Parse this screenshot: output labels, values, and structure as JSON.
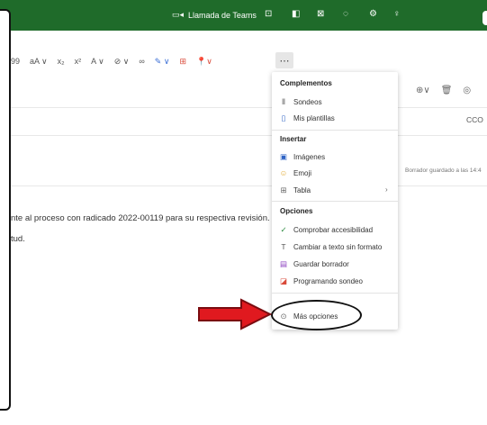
{
  "topbar": {
    "teams_label": "Llamada de Teams",
    "icons": [
      "chat-icon",
      "word-icon",
      "megaphone-icon",
      "bell-icon",
      "gear-icon",
      "lightbulb-icon"
    ]
  },
  "toolbar": {
    "quote": "99",
    "font_size": "aA ∨",
    "subscript": "x₂",
    "superscript": "x²",
    "highlight": "A ∨",
    "link_menu": "⊘ ∨",
    "link": "∞",
    "pen": "✎ ∨",
    "table": "⊞",
    "pin": "📍∨",
    "more": "⋯"
  },
  "compose": {
    "cco_label": "CCO",
    "saved_status": "Borrador guardado a las 14:4",
    "line1": "nte al proceso con radicado 2022-00119 para su respectiva revisión.",
    "line2": "tud."
  },
  "menu": {
    "sections": [
      {
        "title": "Complementos",
        "items": [
          {
            "label": "Sondeos",
            "icon": "chart-icon"
          },
          {
            "label": "Mis plantillas",
            "icon": "document-icon"
          }
        ]
      },
      {
        "title": "Insertar",
        "items": [
          {
            "label": "Imágenes",
            "icon": "image-icon"
          },
          {
            "label": "Emoji",
            "icon": "emoji-icon"
          },
          {
            "label": "Tabla",
            "icon": "table-icon",
            "has_submenu": true
          }
        ]
      },
      {
        "title": "Opciones",
        "items": [
          {
            "label": "Comprobar accesibilidad",
            "icon": "accessibility-icon"
          },
          {
            "label": "Cambiar a texto sin formato",
            "icon": "text-icon"
          },
          {
            "label": "Guardar borrador",
            "icon": "save-icon"
          },
          {
            "label": "Programando sondeo",
            "icon": "schedule-icon"
          }
        ]
      }
    ],
    "more_options": "Más opciones"
  },
  "colors": {
    "topbar": "#1f6b2a",
    "arrow_red": "#e0191f",
    "arrow_dark": "#7a0c10"
  }
}
